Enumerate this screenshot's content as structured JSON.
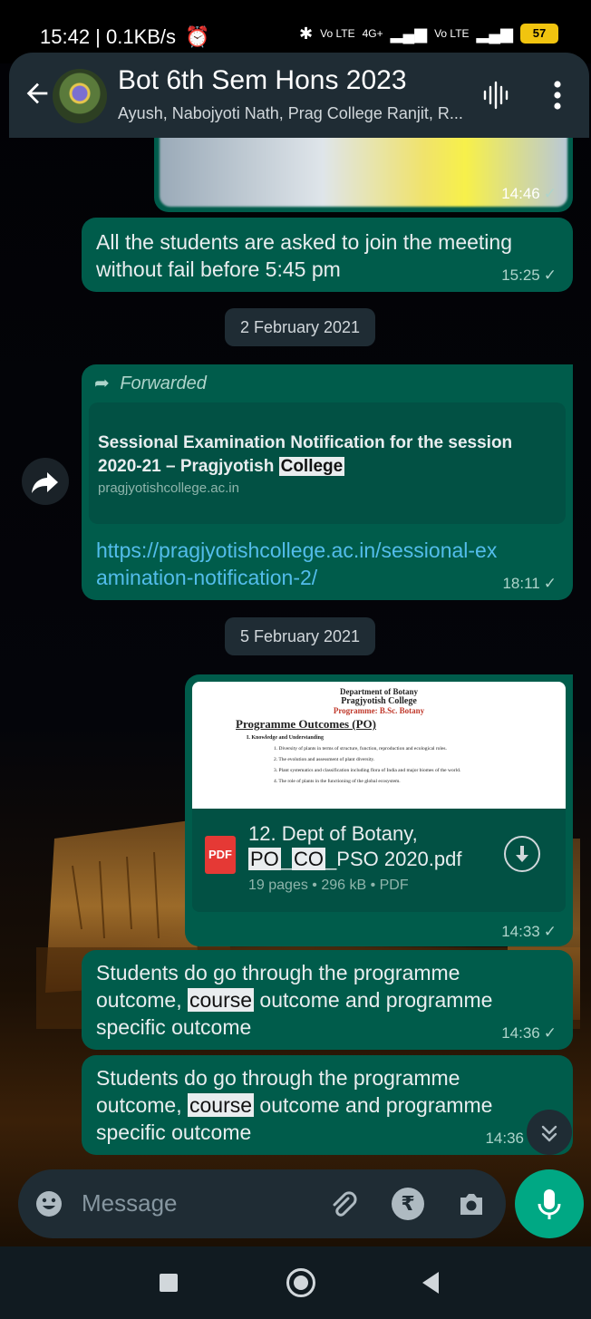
{
  "status": {
    "time": "15:42 | 0.1KB/s",
    "battery": "57",
    "net1": "4G+",
    "volte1": "Vo LTE",
    "volte2": "Vo LTE"
  },
  "header": {
    "title": "Bot 6th Sem Hons 2023",
    "subtitle": "Ayush, Nabojyoti Nath, Prag College Ranjit, R..."
  },
  "messages": {
    "image_time": "14:46",
    "msg1_text": "All the students are asked to join the meeting without fail before 5:45 pm",
    "msg1_time": "15:25",
    "date1": "2 February 2021",
    "fwd_label": "Forwarded",
    "link_title_pre": "Sessional Examination Notification for the session 2020-21 – Pragjyotish ",
    "link_title_hl": "College",
    "link_domain": "pragjyotishcollege.ac.in",
    "link_url": "https://pragjyotishcollege.ac.in/sessional-examination-notification-2/",
    "link_time": "18:11",
    "date2": "5 February 2021",
    "doc_preview": {
      "dept": "Department of Botany",
      "college": "Pragjyotish College",
      "programme": "Programme: B.Sc. Botany",
      "heading": "Programme Outcomes (PO)",
      "section": "I.    Knowledge and Understanding",
      "lines": [
        "1.  Diversity of plants in terms of structure, function, reproduction and ecological roles.",
        "2.  The evolution and assessment of plant diversity.",
        "3.  Plant systematics and classification including flora of India and major biomes of the world.",
        "4.  The role of plants in the functioning of the global ecosystem."
      ]
    },
    "doc_name_line1": "12. Dept of Botany,",
    "doc_name_po": "PO",
    "doc_name_sep1": "_",
    "doc_name_co": "CO",
    "doc_name_rest": "_PSO 2020.pdf",
    "doc_meta": "19 pages • 296 kB • PDF",
    "doc_icon_label": "PDF",
    "doc_time": "14:33",
    "msg2_pre": "Students do go through the programme outcome, ",
    "msg2_hl": "course",
    "msg2_post": " outcome and programme specific outcome",
    "msg2_time": "14:36",
    "msg3_pre": "Students do go through the programme outcome, ",
    "msg3_hl": "course",
    "msg3_post": " outcome and programme specific outcome",
    "msg3_time": "14:36"
  },
  "input": {
    "placeholder": "Message"
  },
  "colors": {
    "outgoing_bubble": "#005c4b",
    "header": "#1f2c34",
    "accent": "#00a884",
    "link": "#53bdeb"
  }
}
